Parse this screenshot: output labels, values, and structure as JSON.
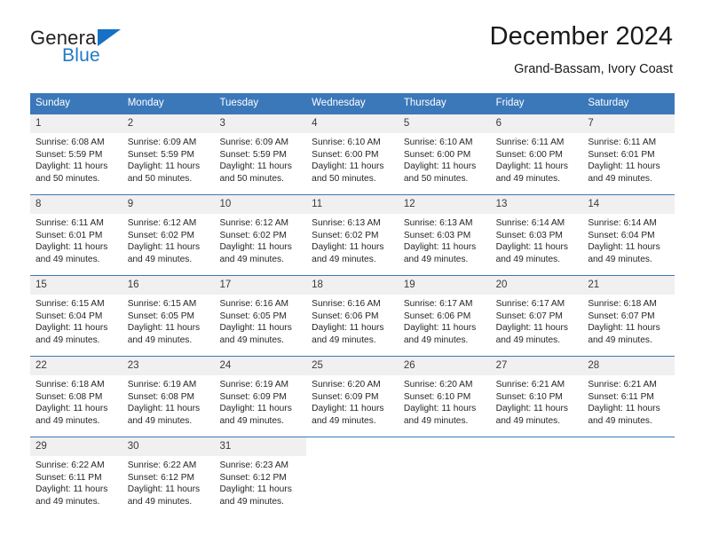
{
  "brand": {
    "name_top": "General",
    "name_bottom": "Blue",
    "triangle_icon": "brand-triangle-icon",
    "color_primary": "#1f7ac4",
    "color_text": "#231f20"
  },
  "header": {
    "title": "December 2024",
    "subtitle": "Grand-Bassam, Ivory Coast"
  },
  "colors": {
    "header_blue": "#3b78ba",
    "day_band_gray": "#f0f0f0",
    "text": "#1a1a1a"
  },
  "weekdays": [
    "Sunday",
    "Monday",
    "Tuesday",
    "Wednesday",
    "Thursday",
    "Friday",
    "Saturday"
  ],
  "weeks": [
    [
      {
        "day": "1",
        "sunrise": "Sunrise: 6:08 AM",
        "sunset": "Sunset: 5:59 PM",
        "daylight_line1": "Daylight: 11 hours",
        "daylight_line2": "and 50 minutes."
      },
      {
        "day": "2",
        "sunrise": "Sunrise: 6:09 AM",
        "sunset": "Sunset: 5:59 PM",
        "daylight_line1": "Daylight: 11 hours",
        "daylight_line2": "and 50 minutes."
      },
      {
        "day": "3",
        "sunrise": "Sunrise: 6:09 AM",
        "sunset": "Sunset: 5:59 PM",
        "daylight_line1": "Daylight: 11 hours",
        "daylight_line2": "and 50 minutes."
      },
      {
        "day": "4",
        "sunrise": "Sunrise: 6:10 AM",
        "sunset": "Sunset: 6:00 PM",
        "daylight_line1": "Daylight: 11 hours",
        "daylight_line2": "and 50 minutes."
      },
      {
        "day": "5",
        "sunrise": "Sunrise: 6:10 AM",
        "sunset": "Sunset: 6:00 PM",
        "daylight_line1": "Daylight: 11 hours",
        "daylight_line2": "and 50 minutes."
      },
      {
        "day": "6",
        "sunrise": "Sunrise: 6:11 AM",
        "sunset": "Sunset: 6:00 PM",
        "daylight_line1": "Daylight: 11 hours",
        "daylight_line2": "and 49 minutes."
      },
      {
        "day": "7",
        "sunrise": "Sunrise: 6:11 AM",
        "sunset": "Sunset: 6:01 PM",
        "daylight_line1": "Daylight: 11 hours",
        "daylight_line2": "and 49 minutes."
      }
    ],
    [
      {
        "day": "8",
        "sunrise": "Sunrise: 6:11 AM",
        "sunset": "Sunset: 6:01 PM",
        "daylight_line1": "Daylight: 11 hours",
        "daylight_line2": "and 49 minutes."
      },
      {
        "day": "9",
        "sunrise": "Sunrise: 6:12 AM",
        "sunset": "Sunset: 6:02 PM",
        "daylight_line1": "Daylight: 11 hours",
        "daylight_line2": "and 49 minutes."
      },
      {
        "day": "10",
        "sunrise": "Sunrise: 6:12 AM",
        "sunset": "Sunset: 6:02 PM",
        "daylight_line1": "Daylight: 11 hours",
        "daylight_line2": "and 49 minutes."
      },
      {
        "day": "11",
        "sunrise": "Sunrise: 6:13 AM",
        "sunset": "Sunset: 6:02 PM",
        "daylight_line1": "Daylight: 11 hours",
        "daylight_line2": "and 49 minutes."
      },
      {
        "day": "12",
        "sunrise": "Sunrise: 6:13 AM",
        "sunset": "Sunset: 6:03 PM",
        "daylight_line1": "Daylight: 11 hours",
        "daylight_line2": "and 49 minutes."
      },
      {
        "day": "13",
        "sunrise": "Sunrise: 6:14 AM",
        "sunset": "Sunset: 6:03 PM",
        "daylight_line1": "Daylight: 11 hours",
        "daylight_line2": "and 49 minutes."
      },
      {
        "day": "14",
        "sunrise": "Sunrise: 6:14 AM",
        "sunset": "Sunset: 6:04 PM",
        "daylight_line1": "Daylight: 11 hours",
        "daylight_line2": "and 49 minutes."
      }
    ],
    [
      {
        "day": "15",
        "sunrise": "Sunrise: 6:15 AM",
        "sunset": "Sunset: 6:04 PM",
        "daylight_line1": "Daylight: 11 hours",
        "daylight_line2": "and 49 minutes."
      },
      {
        "day": "16",
        "sunrise": "Sunrise: 6:15 AM",
        "sunset": "Sunset: 6:05 PM",
        "daylight_line1": "Daylight: 11 hours",
        "daylight_line2": "and 49 minutes."
      },
      {
        "day": "17",
        "sunrise": "Sunrise: 6:16 AM",
        "sunset": "Sunset: 6:05 PM",
        "daylight_line1": "Daylight: 11 hours",
        "daylight_line2": "and 49 minutes."
      },
      {
        "day": "18",
        "sunrise": "Sunrise: 6:16 AM",
        "sunset": "Sunset: 6:06 PM",
        "daylight_line1": "Daylight: 11 hours",
        "daylight_line2": "and 49 minutes."
      },
      {
        "day": "19",
        "sunrise": "Sunrise: 6:17 AM",
        "sunset": "Sunset: 6:06 PM",
        "daylight_line1": "Daylight: 11 hours",
        "daylight_line2": "and 49 minutes."
      },
      {
        "day": "20",
        "sunrise": "Sunrise: 6:17 AM",
        "sunset": "Sunset: 6:07 PM",
        "daylight_line1": "Daylight: 11 hours",
        "daylight_line2": "and 49 minutes."
      },
      {
        "day": "21",
        "sunrise": "Sunrise: 6:18 AM",
        "sunset": "Sunset: 6:07 PM",
        "daylight_line1": "Daylight: 11 hours",
        "daylight_line2": "and 49 minutes."
      }
    ],
    [
      {
        "day": "22",
        "sunrise": "Sunrise: 6:18 AM",
        "sunset": "Sunset: 6:08 PM",
        "daylight_line1": "Daylight: 11 hours",
        "daylight_line2": "and 49 minutes."
      },
      {
        "day": "23",
        "sunrise": "Sunrise: 6:19 AM",
        "sunset": "Sunset: 6:08 PM",
        "daylight_line1": "Daylight: 11 hours",
        "daylight_line2": "and 49 minutes."
      },
      {
        "day": "24",
        "sunrise": "Sunrise: 6:19 AM",
        "sunset": "Sunset: 6:09 PM",
        "daylight_line1": "Daylight: 11 hours",
        "daylight_line2": "and 49 minutes."
      },
      {
        "day": "25",
        "sunrise": "Sunrise: 6:20 AM",
        "sunset": "Sunset: 6:09 PM",
        "daylight_line1": "Daylight: 11 hours",
        "daylight_line2": "and 49 minutes."
      },
      {
        "day": "26",
        "sunrise": "Sunrise: 6:20 AM",
        "sunset": "Sunset: 6:10 PM",
        "daylight_line1": "Daylight: 11 hours",
        "daylight_line2": "and 49 minutes."
      },
      {
        "day": "27",
        "sunrise": "Sunrise: 6:21 AM",
        "sunset": "Sunset: 6:10 PM",
        "daylight_line1": "Daylight: 11 hours",
        "daylight_line2": "and 49 minutes."
      },
      {
        "day": "28",
        "sunrise": "Sunrise: 6:21 AM",
        "sunset": "Sunset: 6:11 PM",
        "daylight_line1": "Daylight: 11 hours",
        "daylight_line2": "and 49 minutes."
      }
    ],
    [
      {
        "day": "29",
        "sunrise": "Sunrise: 6:22 AM",
        "sunset": "Sunset: 6:11 PM",
        "daylight_line1": "Daylight: 11 hours",
        "daylight_line2": "and 49 minutes."
      },
      {
        "day": "30",
        "sunrise": "Sunrise: 6:22 AM",
        "sunset": "Sunset: 6:12 PM",
        "daylight_line1": "Daylight: 11 hours",
        "daylight_line2": "and 49 minutes."
      },
      {
        "day": "31",
        "sunrise": "Sunrise: 6:23 AM",
        "sunset": "Sunset: 6:12 PM",
        "daylight_line1": "Daylight: 11 hours",
        "daylight_line2": "and 49 minutes."
      },
      {
        "day": "",
        "sunrise": "",
        "sunset": "",
        "daylight_line1": "",
        "daylight_line2": ""
      },
      {
        "day": "",
        "sunrise": "",
        "sunset": "",
        "daylight_line1": "",
        "daylight_line2": ""
      },
      {
        "day": "",
        "sunrise": "",
        "sunset": "",
        "daylight_line1": "",
        "daylight_line2": ""
      },
      {
        "day": "",
        "sunrise": "",
        "sunset": "",
        "daylight_line1": "",
        "daylight_line2": ""
      }
    ]
  ]
}
